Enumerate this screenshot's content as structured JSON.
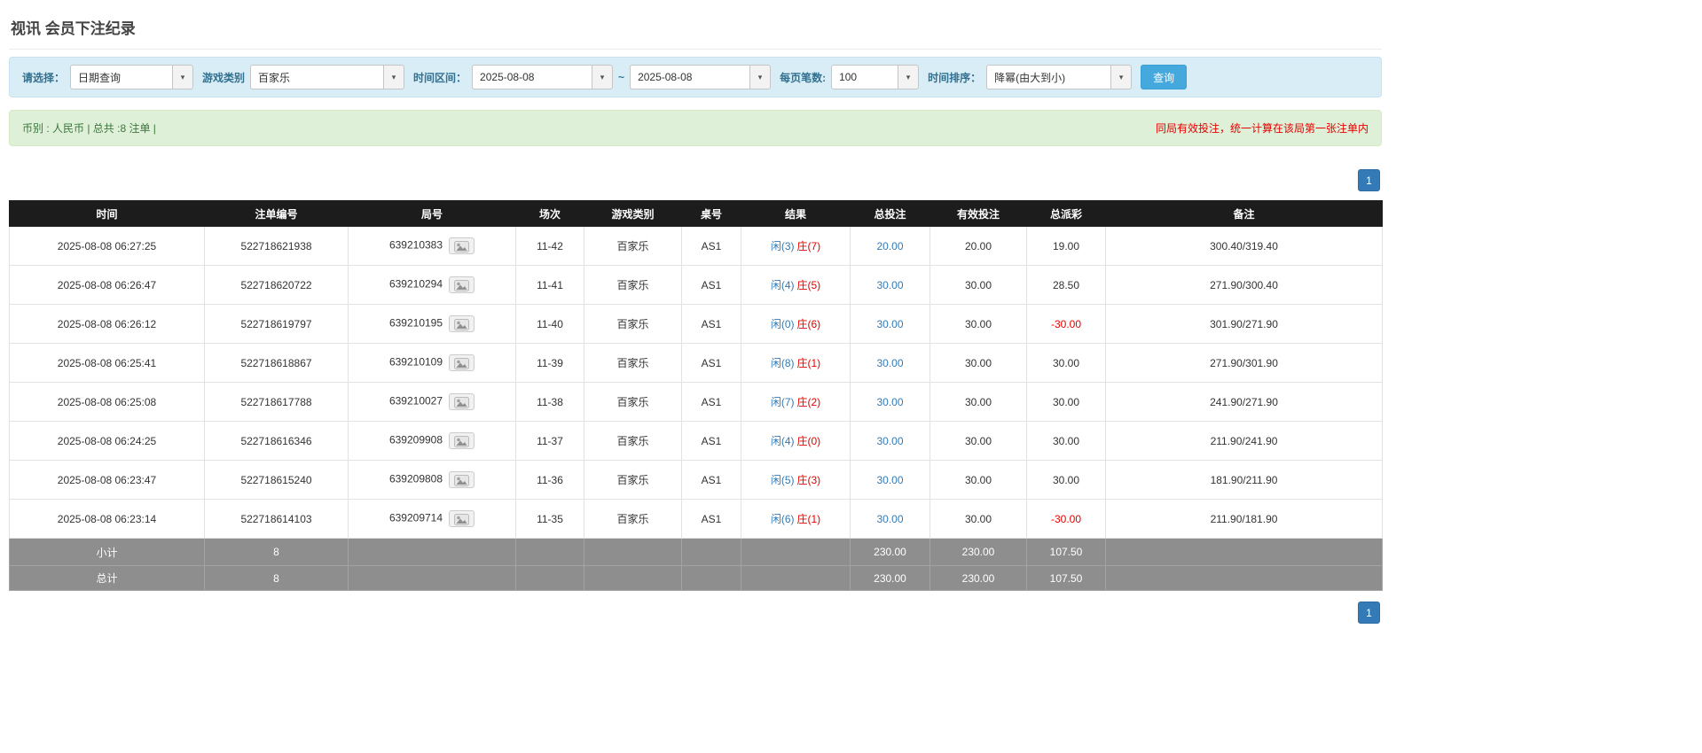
{
  "page": {
    "title": "视讯 会员下注纪录"
  },
  "colors": {
    "accent_blue": "#337ab7",
    "player_blue": "#337ab7",
    "banker_red": "#e60000",
    "negative_red": "#e60000",
    "notice_red": "#e60000",
    "filter_bg": "#d9edf7",
    "filter_label": "#31708f",
    "search_btn_bg": "#45a9dd",
    "info_bg": "#dff0d8",
    "info_text": "#3c763d",
    "header_bg": "#1c1c1c",
    "footer_bg": "#8e8e8e"
  },
  "icons": {
    "caret_down": "▾",
    "round_detail": "game-result-image-icon"
  },
  "filters": {
    "select_label": "请选择：",
    "select_value": "日期查询",
    "game_type_label": "游戏类别",
    "game_type_value": "百家乐",
    "date_range_label": "时间区间：",
    "date_from": "2025-08-08",
    "date_separator": "~",
    "date_to": "2025-08-08",
    "page_size_label": "每页笔数:",
    "page_size_value": "100",
    "sort_label": "时间排序：",
    "sort_value": "降幂(由大到小)",
    "search_button": "查询"
  },
  "info_bar": {
    "summary": "币别 : 人民币 | 总共 :8 注单 |",
    "notice": "同局有效投注，统一计算在该局第一张注单内"
  },
  "pagination": {
    "top_page": "1",
    "bottom_page": "1"
  },
  "table": {
    "headers": [
      "时间",
      "注单编号",
      "局号",
      "场次",
      "游戏类别",
      "桌号",
      "结果",
      "总投注",
      "有效投注",
      "总派彩",
      "备注"
    ],
    "rows": [
      {
        "time": "2025-08-08 06:27:25",
        "bet_id": "522718621938",
        "round_id": "639210383",
        "session": "11-42",
        "game": "百家乐",
        "table_no": "AS1",
        "player": "闲(3)",
        "banker": "庄(7)",
        "total_bet": "20.00",
        "valid_bet": "20.00",
        "payout": "19.00",
        "note": "300.40/319.40"
      },
      {
        "time": "2025-08-08 06:26:47",
        "bet_id": "522718620722",
        "round_id": "639210294",
        "session": "11-41",
        "game": "百家乐",
        "table_no": "AS1",
        "player": "闲(4)",
        "banker": "庄(5)",
        "total_bet": "30.00",
        "valid_bet": "30.00",
        "payout": "28.50",
        "note": "271.90/300.40"
      },
      {
        "time": "2025-08-08 06:26:12",
        "bet_id": "522718619797",
        "round_id": "639210195",
        "session": "11-40",
        "game": "百家乐",
        "table_no": "AS1",
        "player": "闲(0)",
        "banker": "庄(6)",
        "total_bet": "30.00",
        "valid_bet": "30.00",
        "payout": "-30.00",
        "note": "301.90/271.90"
      },
      {
        "time": "2025-08-08 06:25:41",
        "bet_id": "522718618867",
        "round_id": "639210109",
        "session": "11-39",
        "game": "百家乐",
        "table_no": "AS1",
        "player": "闲(8)",
        "banker": "庄(1)",
        "total_bet": "30.00",
        "valid_bet": "30.00",
        "payout": "30.00",
        "note": "271.90/301.90"
      },
      {
        "time": "2025-08-08 06:25:08",
        "bet_id": "522718617788",
        "round_id": "639210027",
        "session": "11-38",
        "game": "百家乐",
        "table_no": "AS1",
        "player": "闲(7)",
        "banker": "庄(2)",
        "total_bet": "30.00",
        "valid_bet": "30.00",
        "payout": "30.00",
        "note": "241.90/271.90"
      },
      {
        "time": "2025-08-08 06:24:25",
        "bet_id": "522718616346",
        "round_id": "639209908",
        "session": "11-37",
        "game": "百家乐",
        "table_no": "AS1",
        "player": "闲(4)",
        "banker": "庄(0)",
        "total_bet": "30.00",
        "valid_bet": "30.00",
        "payout": "30.00",
        "note": "211.90/241.90"
      },
      {
        "time": "2025-08-08 06:23:47",
        "bet_id": "522718615240",
        "round_id": "639209808",
        "session": "11-36",
        "game": "百家乐",
        "table_no": "AS1",
        "player": "闲(5)",
        "banker": "庄(3)",
        "total_bet": "30.00",
        "valid_bet": "30.00",
        "payout": "30.00",
        "note": "181.90/211.90"
      },
      {
        "time": "2025-08-08 06:23:14",
        "bet_id": "522718614103",
        "round_id": "639209714",
        "session": "11-35",
        "game": "百家乐",
        "table_no": "AS1",
        "player": "闲(6)",
        "banker": "庄(1)",
        "total_bet": "30.00",
        "valid_bet": "30.00",
        "payout": "-30.00",
        "note": "211.90/181.90"
      }
    ],
    "subtotal": {
      "label": "小计",
      "count": "8",
      "total_bet": "230.00",
      "valid_bet": "230.00",
      "payout": "107.50"
    },
    "total": {
      "label": "总计",
      "count": "8",
      "total_bet": "230.00",
      "valid_bet": "230.00",
      "payout": "107.50"
    }
  }
}
